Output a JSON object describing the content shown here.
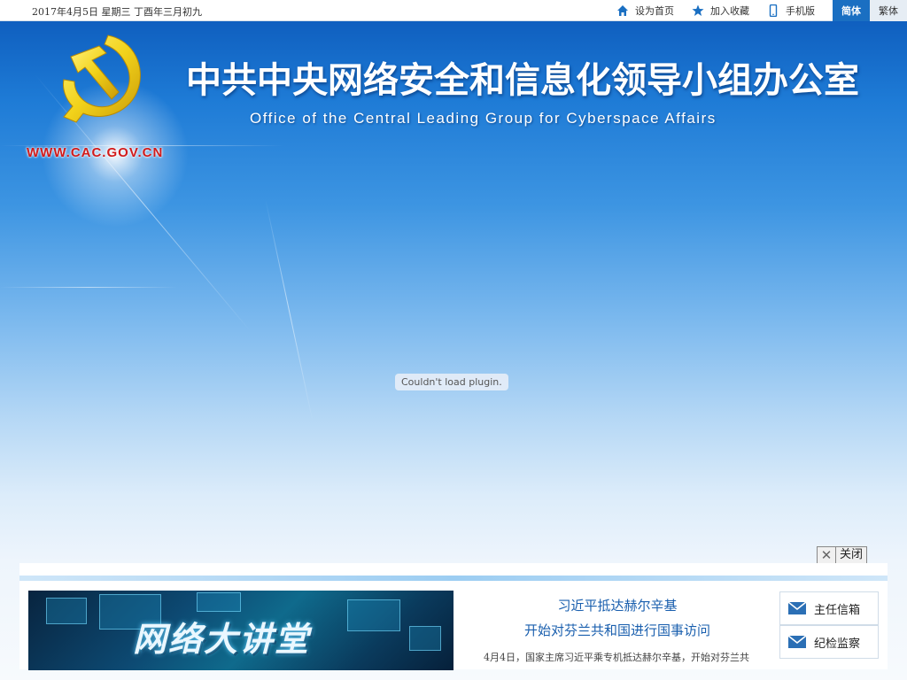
{
  "topbar": {
    "date": "2017年4月5日 星期三 丁酉年三月初九",
    "links": [
      {
        "label": "设为首页",
        "icon": "home-icon"
      },
      {
        "label": "加入收藏",
        "icon": "star-icon"
      },
      {
        "label": "手机版",
        "icon": "mobile-icon"
      }
    ],
    "lang": {
      "simplified": "简体",
      "traditional": "繁体"
    }
  },
  "banner": {
    "url": "WWW.CAC.GOV.CN",
    "title_cn": "中共中央网络安全和信息化领导小组办公室",
    "title_en": "Office of the Central Leading Group for Cyberspace Affairs",
    "plugin_message": "Couldn't load plugin."
  },
  "close_bar": {
    "close_label": "关闭"
  },
  "feature": {
    "title": "网络大讲堂"
  },
  "news": {
    "headline_line1": "习近平抵达赫尔辛基",
    "headline_line2": "开始对芬兰共和国进行国事访问",
    "summary": "4月4日，国家主席习近平乘专机抵达赫尔辛基，开始对芬兰共"
  },
  "side": {
    "items": [
      {
        "label": "主任信箱",
        "icon": "mail-icon"
      },
      {
        "label": "纪检监察",
        "icon": "mail-icon"
      }
    ]
  },
  "colors": {
    "brand_blue": "#1a6fc2",
    "url_red": "#d11b1b",
    "headline_blue": "#1a5fae",
    "emblem_gold": "#f2d21a"
  }
}
